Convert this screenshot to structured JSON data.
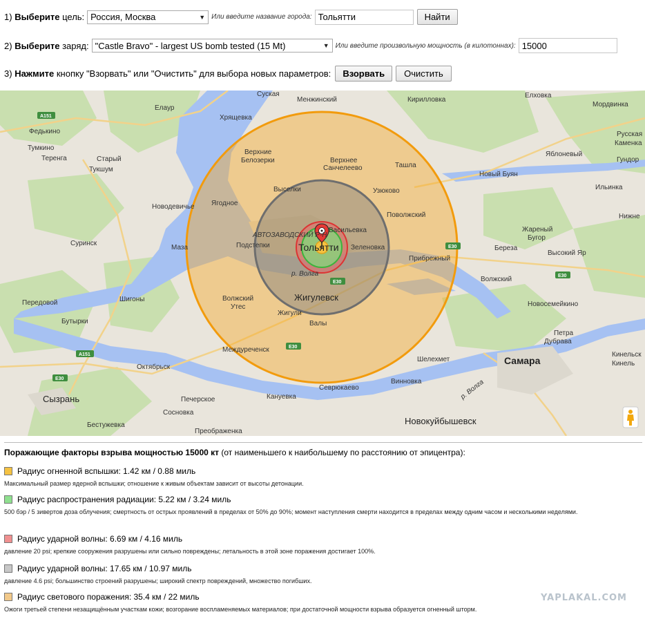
{
  "controls": {
    "step1": {
      "num": "1)",
      "bold": "Выберите",
      "rest": "цель:",
      "select_value": "Россия, Москва",
      "hint": "Или введите название города:",
      "city_value": "Тольятти",
      "button": "Найти"
    },
    "step2": {
      "num": "2)",
      "bold": "Выберите",
      "rest": "заряд:",
      "select_value": "\"Castle Bravo\" - largest US bomb tested (15 Mt)",
      "hint": "Или введите произвольную мощность (в килотоннах):",
      "yield_value": "15000"
    },
    "step3": {
      "num": "3)",
      "bold": "Нажмите",
      "rest": "кнопку \"Взорвать\" или \"Очистить\" для выбора новых параметров:",
      "detonate_button": "Взорвать",
      "clear_button": "Очистить"
    }
  },
  "map": {
    "labels": {
      "suskan": "Суская",
      "menzhinsky": "Менжинский",
      "kirillovka": "Кирилловка",
      "elkhovka": "Елховка",
      "mordvinka": "Мордвинка",
      "elaur": "Елаур",
      "khryashchevka": "Хрящевка",
      "fedkino": "Федькино",
      "tumkino": "Тумкино",
      "terenga": "Теренга",
      "stary_tukshum": "Старый",
      "stary_tukshum2": "Тукшум",
      "verkhnie_belozerki": "Верхние",
      "verkhnie_belozerki2": "Белозерки",
      "verkhnee_sancheleevo": "Верхнее",
      "verkhnee_sancheleevo2": "Санчелеево",
      "tashla": "Ташла",
      "yablonevy": "Яблоневый",
      "novy_buyan": "Новый Буян",
      "russkaya": "Русская",
      "russkaya2": "Каменка",
      "gundorovka": "Гундор",
      "novodevichye": "Новодевичье",
      "yagodnoe": "Ягодное",
      "vyselki": "Выселки",
      "uzyukovo": "Узюково",
      "povolzhsky": "Поволжский",
      "ilyinka": "Ильинка",
      "nizhnee": "Нижне",
      "surinsk": "Суринск",
      "maza": "Маза",
      "avtozavodsky": "АВТОЗАВОДСКИЙ Р-Н",
      "podstepki": "Подстепки",
      "togliatti": "Тольятти",
      "vasilyevka": "Васильевка",
      "zelenovka": "Зеленовка",
      "zharenyi": "Жареный",
      "zharenyi2": "Бугор",
      "bereza": "Береза",
      "vysokiy_yar": "Высокий Яр",
      "pribrezhny": "Прибрежный",
      "volzhsky": "Волжский",
      "volga": "р. Волга",
      "peredovoy": "Передовой",
      "shigony": "Шигоны",
      "volzhsky_utes": "Волжский",
      "volzhsky_utes2": "Утес",
      "zhigulevsk": "Жигулевск",
      "zhiguli": "Жигули",
      "valy": "Валы",
      "novosemeikino": "Новосемейкино",
      "butyrki": "Бутырки",
      "petra_dubrava": "Петра",
      "petra_dubrava2": "Дубрава",
      "mezhdurechensk": "Междуреченск",
      "shelekhmet": "Шелехмет",
      "samara": "Самара",
      "kinelskiy": "Кинельск",
      "kinel": "Кинель",
      "oktyabrsk": "Октябрьск",
      "syzran": "Сызрань",
      "vinnovka": "Винновка",
      "sevryukaevo": "Севрюкаево",
      "kanuevka": "Кануевка",
      "pechersk": "Печерское",
      "sosnovka": "Сосновка",
      "novokuybyshevsk": "Новокуйбышевск",
      "bestuzhevka": "Бестужевка",
      "preobrazhenka": "Преображенка",
      "volga2": "р. Волга"
    },
    "roads": {
      "a151": "A151",
      "e30": "E30"
    }
  },
  "legend": {
    "title_bold": "Поражающие факторы взрыва мощностью 15000 кт",
    "title_rest": " (от наименьшего к наибольшему по расстоянию от эпицентра):",
    "items": [
      {
        "label": "Радиус огненной вспышки: 1.42 км / 0.88 миль",
        "desc": "Максимальный размер ядерной вспышки; отношение к живым объектам зависит от высоты детонации.",
        "color": "#f5c242"
      },
      {
        "label": "Радиус распространения радиации: 5.22 км / 3.24 миль",
        "desc": "500 бэр / 5 зивертов доза облучения; смертность от острых проявлений в пределах от 50% до 90%; момент наступления смерти находится в пределах между одним часом и несколькими неделями.",
        "color": "#8fe08f"
      },
      {
        "label": "Радиус ударной волны: 6.69 км / 4.16 миль",
        "desc": "давление 20 psi; крепкие сооружения разрушены или сильно повреждены; летальность в этой зоне поражения достигает 100%.",
        "color": "#f09090"
      },
      {
        "label": "Радиус ударной волны: 17.65 км / 10.97 миль",
        "desc": "давление 4.6 psi; большинство строений разрушены; широкий спектр повреждений, множество погибших.",
        "color": "#c8c8c8"
      },
      {
        "label": "Радиус светового поражения: 35.4 км / 22 миль",
        "desc": "Ожоги третьей степени незащищённым участкам кожи; возгорание воспламеняемых материалов; при достаточной мощности взрыва образуется огненный шторм.",
        "color": "#f2c98a"
      }
    ]
  },
  "watermark": "YAPLAKAL.COM"
}
